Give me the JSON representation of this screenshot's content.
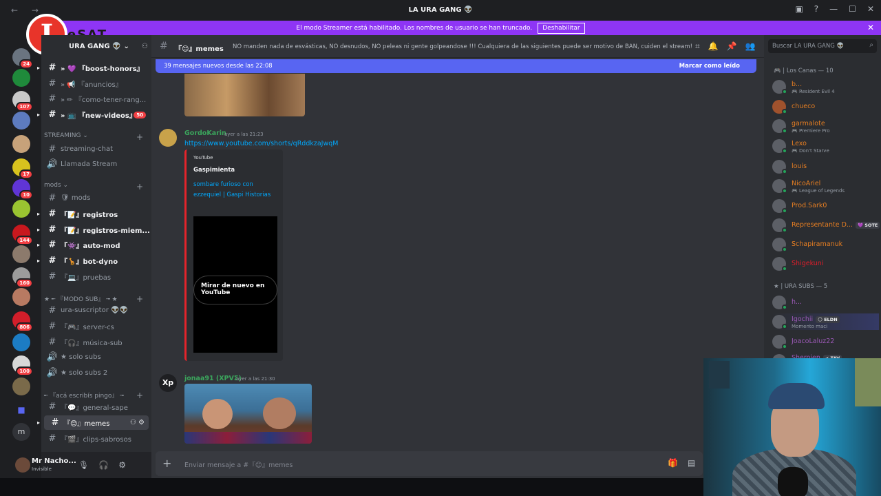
{
  "titlebar": {
    "title": "LA URA GANG 👽",
    "nav": "← →",
    "controls": [
      "▣",
      "?",
      "—",
      "☐",
      "✕"
    ]
  },
  "streamer_bar": {
    "text": "El modo Streamer está habilitado. Los nombres de usuario se han truncado.",
    "button": "Deshabilitar",
    "close": "✕"
  },
  "watermark": {
    "letter": "I",
    "text": "eSAT"
  },
  "servers": [
    {
      "badge": "24"
    },
    {
      "badge": ""
    },
    {
      "badge": "107"
    },
    {
      "badge": ""
    },
    {
      "badge": ""
    },
    {
      "badge": "17"
    },
    {
      "badge": "10"
    },
    {
      "badge": ""
    },
    {
      "badge": "144"
    },
    {
      "badge": ""
    },
    {
      "badge": "160"
    },
    {
      "badge": ""
    },
    {
      "badge": "806"
    },
    {
      "badge": ""
    },
    {
      "badge": "100"
    },
    {
      "badge": ""
    },
    {
      "badge": ""
    },
    {
      "badge": "m"
    }
  ],
  "guild": {
    "name": "URA GANG 👽",
    "chevron": "⌄"
  },
  "channels": [
    {
      "icon": "#",
      "label": "» 💜 『boost-honors』",
      "bold": true
    },
    {
      "icon": "#",
      "label": "» 📢 『anuncios』",
      "bold": false
    },
    {
      "icon": "#",
      "label": "» ✏ 『como-tener-rang...",
      "bold": false
    },
    {
      "icon": "#",
      "label": "» 📺 『new-videos』",
      "bold": true,
      "count": "50"
    }
  ],
  "categories": {
    "streaming": "STREAMING",
    "mods": "mods",
    "modo_sub": "★ ╾ 『MODO SUB』 ╼ ★",
    "general": "╾ 『acá escribís pingo』 ╼"
  },
  "streaming_channels": [
    {
      "icon": "#",
      "label": "streaming-chat"
    },
    {
      "icon": "🔊",
      "label": "Llamada Stream"
    }
  ],
  "mods_channels": [
    {
      "icon": "#",
      "label": "🛡 mods",
      "bold": false
    },
    {
      "icon": "#",
      "label": "『📝』registros",
      "bold": true
    },
    {
      "icon": "#",
      "label": "『📝』registros-miem...",
      "bold": true
    },
    {
      "icon": "#",
      "label": "『👾』auto-mod",
      "bold": true
    },
    {
      "icon": "#",
      "label": "『🦒』bot-dyno",
      "bold": true
    },
    {
      "icon": "#",
      "label": "『💻』pruebas",
      "bold": false
    }
  ],
  "sub_channels": [
    {
      "icon": "#",
      "label": "ura-suscriptor 👽👽"
    },
    {
      "icon": "#",
      "label": "『🎮』server-cs"
    },
    {
      "icon": "#",
      "label": "『🎧』música-sub"
    },
    {
      "icon": "🔊",
      "label": "★ solo subs"
    },
    {
      "icon": "🔊",
      "label": "★ solo subs 2"
    }
  ],
  "general_channels": [
    {
      "icon": "#",
      "label": "『💬』general-sape",
      "selected": false
    },
    {
      "icon": "#",
      "label": "『😊』memes",
      "selected": true
    },
    {
      "icon": "#",
      "label": "『🎬』clips-sabrosos",
      "selected": false
    }
  ],
  "user_panel": {
    "name": "Mr Nacho...",
    "status": "Invisible",
    "mic": "🎙",
    "headset": "🎧",
    "settings": "⚙"
  },
  "header": {
    "channel": "『😊』memes",
    "topic": "NO manden nada de esvásticas, NO desnudos, NO peleas ni gente golpeandose !!! Cualquiera de las siguientes puede ser motivo de BAN, cuiden el stream!"
  },
  "new_messages_bar": {
    "text": "39 mensajes nuevos desde las 22:08",
    "action": "Marcar como leído"
  },
  "messages": [
    {
      "author": "GordoKarin",
      "author_color": "#3ba55c",
      "time": "ayer a las 21:23",
      "link": "https://www.youtube.com/shorts/qRddkzaJwqM",
      "embed": {
        "provider": "YouTube",
        "author": "Gaspimienta",
        "title": "sombare furioso con ezzequiel | Gaspi Historias",
        "replay": "Mirar de nuevo en YouTube"
      }
    },
    {
      "author": "jonaa91 (XPVΣ)",
      "author_color": "#3ba55c",
      "time": "ayer a las 21:30",
      "avatar_text": "Xp"
    }
  ],
  "composer": {
    "placeholder": "Enviar mensaje a #『😊』memes",
    "plus": "+"
  },
  "members": {
    "search_placeholder": "Buscar LA URA GANG 👽",
    "group1": "🎮 | Los Canas — 10",
    "group1_members": [
      {
        "name": "b...",
        "status": "🎮 Resident Evil 4",
        "color": "#e67e22"
      },
      {
        "name": "chueco",
        "status": "",
        "color": "#e67e22"
      },
      {
        "name": "garmalote",
        "status": "🎮 Premiere Pro",
        "color": "#e67e22"
      },
      {
        "name": "Lexo",
        "status": "🎮 Don't Starve",
        "color": "#e67e22"
      },
      {
        "name": "louis",
        "status": "",
        "color": "#e67e22"
      },
      {
        "name": "NicoAriel",
        "status": "🎮 League of Legends",
        "color": "#e67e22"
      },
      {
        "name": "Prod.Sark0",
        "status": "",
        "color": "#e67e22"
      },
      {
        "name": "Representante D...",
        "status": "",
        "color": "#e67e22",
        "tag": "💜 SOTE"
      },
      {
        "name": "Schapiramanuk",
        "status": "",
        "color": "#e67e22"
      },
      {
        "name": "Shigekuni",
        "status": "",
        "color": "#e11d2a"
      }
    ],
    "group2": "★ | URA SUBS — 5",
    "group2_members": [
      {
        "name": "h...",
        "status": "",
        "color": "#9b59b6"
      },
      {
        "name": "Igochii",
        "status": "Momento maci",
        "color": "#9b59b6",
        "tag": "🌕 ELDN"
      },
      {
        "name": "JoacoLaluz22",
        "status": "",
        "color": "#9b59b6"
      },
      {
        "name": "Sheroien",
        "status": "",
        "color": "#9b59b6",
        "tag": "✔ TAV"
      }
    ]
  },
  "colors": {
    "accent": "#5865f2",
    "streamer": "#8e35f5",
    "badge": "#f23f43",
    "online": "#23a55a"
  }
}
